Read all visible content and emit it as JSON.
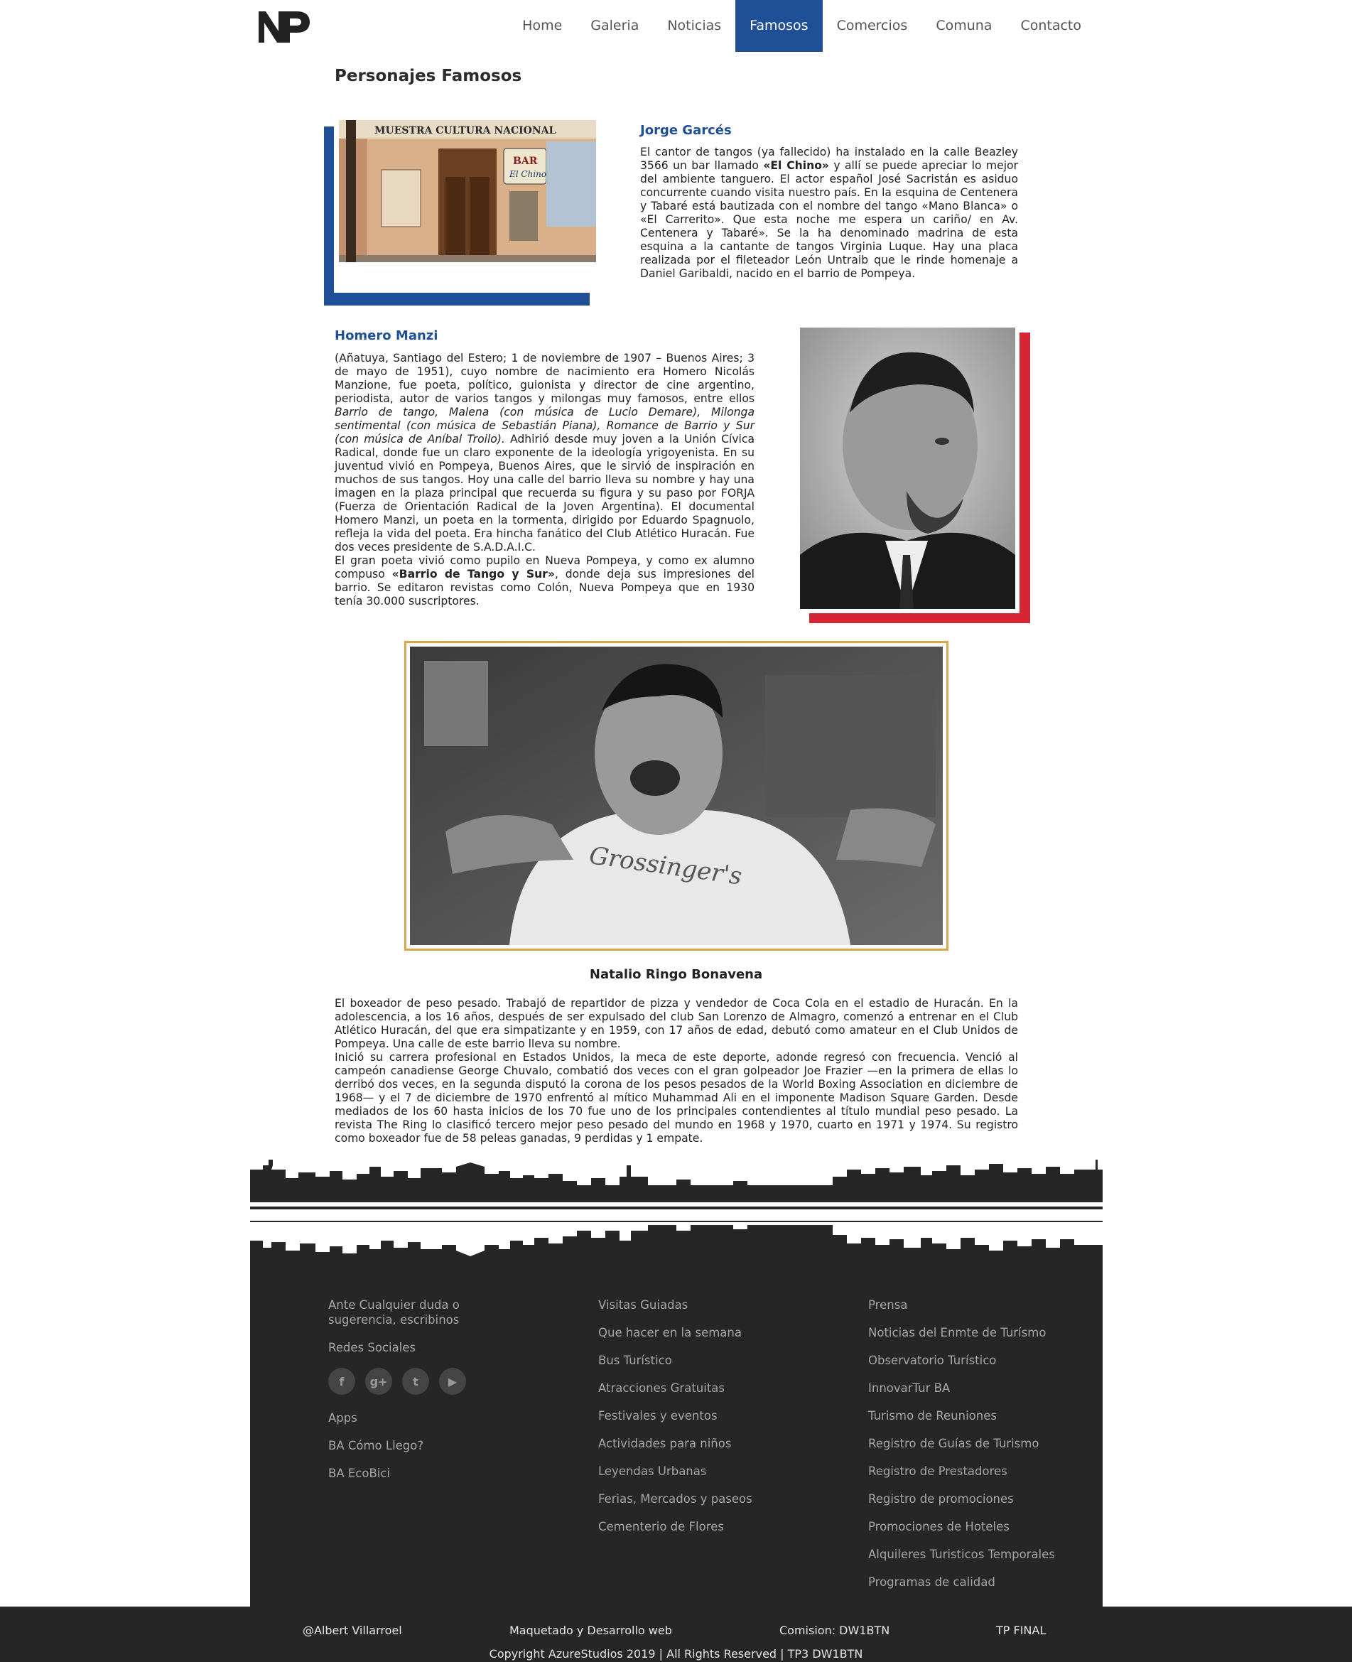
{
  "nav": {
    "logo": "NP",
    "items": [
      "Home",
      "Galeria",
      "Noticias",
      "Famosos",
      "Comercios",
      "Comuna",
      "Contacto"
    ],
    "active": "Famosos"
  },
  "page": {
    "title": "Personajes Famosos"
  },
  "section1": {
    "name": "Jorge Garcés",
    "text_a": "El cantor de tangos (ya fallecido) ha instalado en la calle Beazley 3566 un bar llamado ",
    "text_b": "«El Chino»",
    "text_c": " y allí se puede apreciar lo mejor del ambiente tanguero. El actor español José Sacristán es asiduo concurrente cuando visita nuestro país. En la esquina de Centenera y Tabaré está bautizada con el nombre del tango «Mano Blanca» o «El Carrerito». Que esta noche me espera un cariño/ en Av. Centenera y Tabaré». Se la ha denominado madrina de esta esquina a la cantante de tangos Virginia Luque. Hay una placa realizada por el fileteador León Untraib que le rinde homenaje a Daniel Garibaldi, nacido en el barrio de Pompeya.",
    "photo_signs": [
      "MUESTRA CULTURA NACIONAL",
      "BAR",
      "El Chino"
    ]
  },
  "section2": {
    "name": "Homero Manzi",
    "text_a": "(Añatuya, Santiago del Estero; 1 de noviembre de 1907 – Buenos Aires; 3 de mayo de 1951), cuyo nombre de nacimiento era Homero Nicolás Manzione, fue poeta, político, guionista y director de cine argentino, periodista, autor de varios tangos y milongas muy famosos, entre ellos ",
    "text_italic": "Barrio de tango, Malena (con música de Lucio Demare), Milonga sentimental (con música de Sebastián Piana), Romance de Barrio y Sur (con música de Aníbal Troilo).",
    "text_b": " Adhirió desde muy joven a la Unión Cívica Radical, donde fue un claro exponente de la ideología yrigoyenista. En su juventud vivió en Pompeya, Buenos Aires, que le sirvió de inspiración en muchos de sus tangos. Hoy una calle del barrio lleva su nombre y hay una imagen en la plaza principal que recuerda su figura y su paso por FORJA (Fuerza de Orientación Radical de la Joven Argentina). El documental Homero Manzi, un poeta en la tormenta, dirigido por Eduardo Spagnuolo, refleja la vida del poeta. Era hincha fanático del Club Atlético Huracán. Fue dos veces presidente de S.A.D.A.I.C.",
    "text_c": "El gran poeta vivió como pupilo en Nueva Pompeya, y como ex alumno compuso ",
    "text_bold": "«Barrio de Tango y Sur»",
    "text_d": ", donde deja sus impresiones del barrio. Se editaron revistas como Colón, Nueva Pompeya que en 1930 tenía 30.000 suscriptores."
  },
  "section3": {
    "name": "Natalio Ringo Bonavena",
    "shirt_text": "Grossinger's",
    "para1": "El boxeador de peso pesado. Trabajó de repartidor de pizza y vendedor de Coca Cola en el estadio de Huracán. En la adolescencia, a los 16 años, después de ser expulsado del club San Lorenzo de Almagro, comenzó a entrenar en el Club Atlético Huracán, del que era simpatizante y en 1959, con 17 años de edad, debutó como amateur en el Club Unidos de Pompeya. Una calle de este barrio lleva su nombre.",
    "para2": "Inició su carrera profesional en Estados Unidos, la meca de este deporte, adonde regresó con frecuencia. Venció al campeón canadiense George Chuvalo, combatió dos veces con el gran golpeador Joe Frazier —en la primera de ellas lo derribó dos veces, en la segunda disputó la corona de los pesos pesados de la World Boxing Association en diciembre de 1968— y el 7 de diciembre de 1970 enfrentó al mítico Muhammad Ali en el imponente Madison Square Garden. Desde mediados de los 60 hasta inicios de los 70 fue uno de los principales contendientes al título mundial peso pesado. La revista The Ring lo clasificó tercero mejor peso pesado del mundo en 1968 y 1970, cuarto en 1971 y 1974. Su registro como boxeador fue de 58 peleas ganadas, 9 perdidas y 1 empate."
  },
  "footer": {
    "col1": {
      "contact": "Ante Cualquier duda o sugerencia, escribinos",
      "social_label": "Redes Sociales",
      "social": [
        "facebook-icon",
        "google-plus-icon",
        "twitter-icon",
        "youtube-icon"
      ],
      "social_glyphs": [
        "f",
        "g+",
        "t",
        "▶"
      ],
      "apps_label": "Apps",
      "apps": [
        "BA Cómo Llego?",
        "BA EcoBici"
      ]
    },
    "col2": [
      "Visitas Guiadas",
      "Que hacer en la semana",
      "Bus Turístico",
      "Atracciones Gratuitas",
      "Festivales y eventos",
      "Actividades para niños",
      "Leyendas Urbanas",
      "Ferias, Mercados y paseos",
      "Cementerio de Flores"
    ],
    "col3": [
      "Prensa",
      "Noticias del Enmte de Turísmo",
      "Observatorio Turístico",
      "InnovarTur BA",
      "Turismo de Reuniones",
      "Registro de Guías de Turismo",
      "Registro de Prestadores",
      "Registro de promociones",
      "Promociones de Hoteles",
      "Alquileres Turisticos Temporales",
      "Programas de calidad"
    ]
  },
  "bottom": {
    "author": "@Albert Villarroel",
    "made": "Maquetado y Desarrollo web",
    "comision": "Comision: DW1BTN",
    "tp": "TP FINAL",
    "copyright": "Copyright AzureStudios 2019 | All Rights Reserved | TP3 DW1BTN"
  },
  "colors": {
    "accent_blue": "#1f4f97",
    "accent_red": "#d62535",
    "frame_gold": "#d8a94c",
    "footer_bg": "#262626"
  }
}
